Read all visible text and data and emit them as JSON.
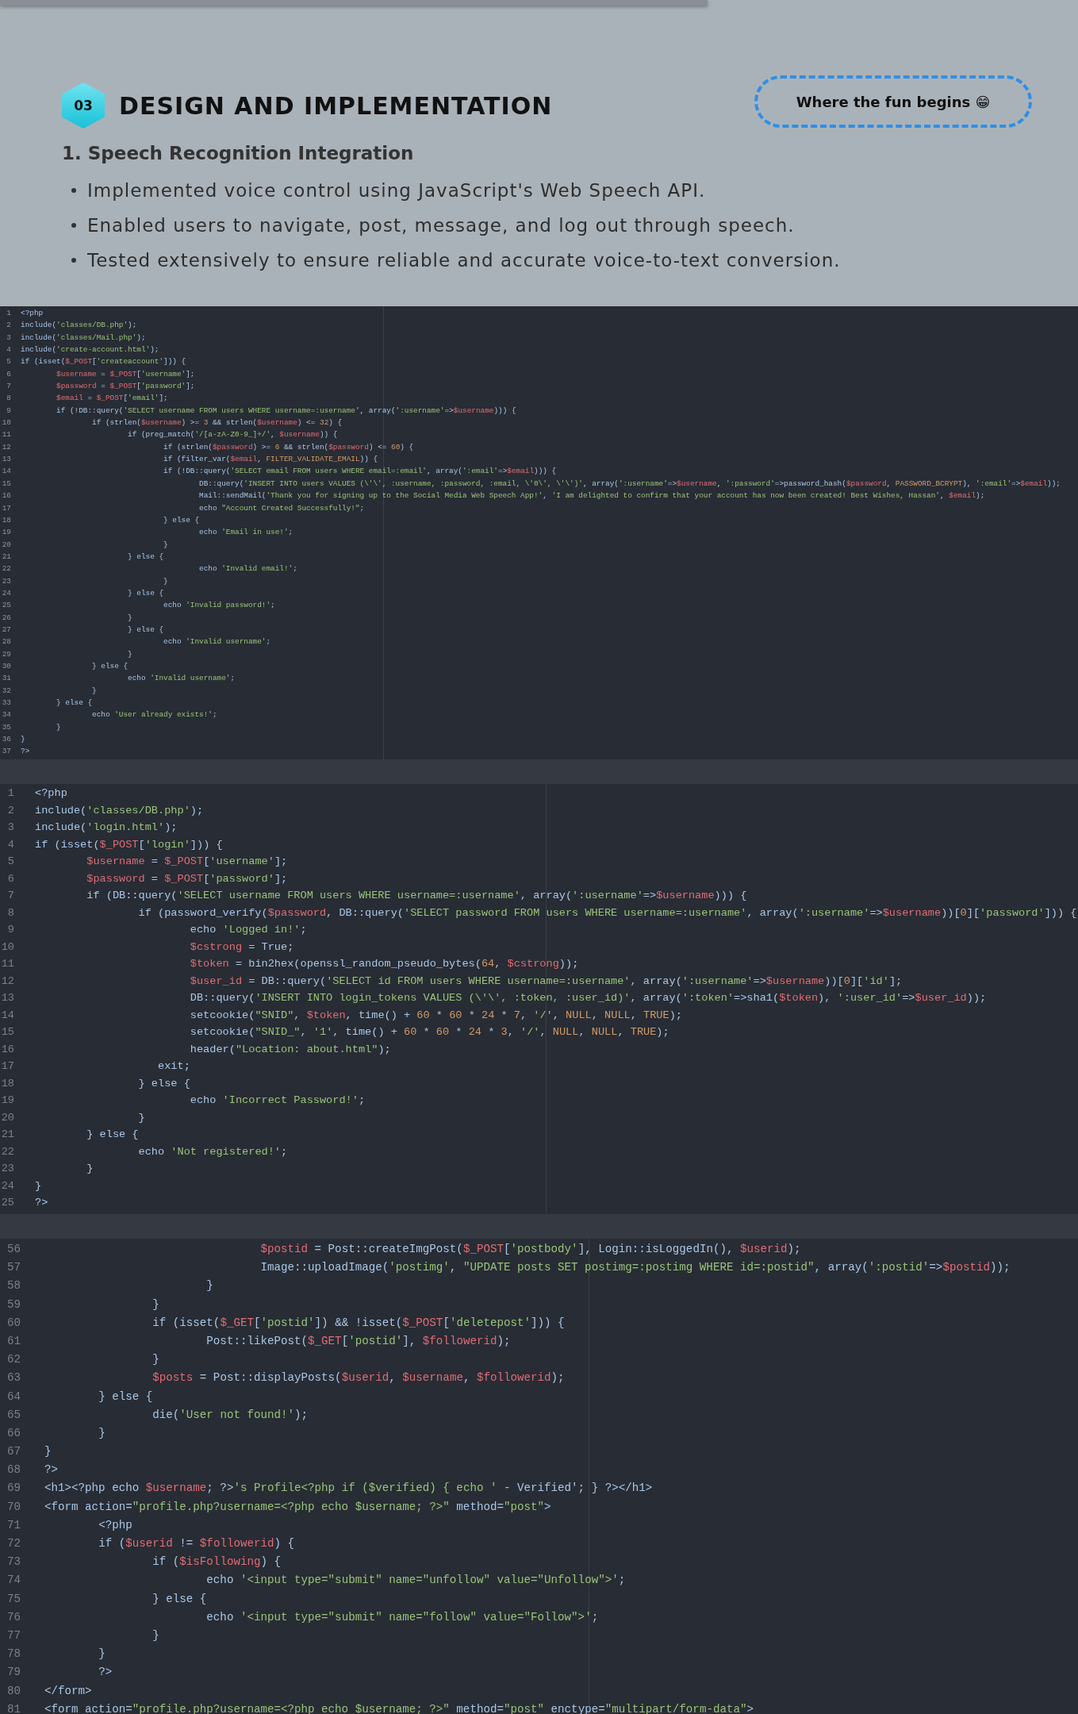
{
  "header": {
    "section_number": "03",
    "title": "DESIGN AND IMPLEMENTATION",
    "tagline": "Where the fun begins 😁",
    "subheading": "1. Speech Recognition Integration",
    "bullets": [
      "Implemented voice control using JavaScript's Web Speech API.",
      "Enabled users to navigate, post, message, and log out through speech.",
      "Tested extensively to ensure reliable and accurate voice-to-text conversion."
    ]
  },
  "code_panels": [
    {
      "kind": "small",
      "lines": [
        {
          "n": "1",
          "code": "<?php"
        },
        {
          "n": "2",
          "code": "include('classes/DB.php');"
        },
        {
          "n": "3",
          "code": "include('classes/Mail.php');"
        },
        {
          "n": "4",
          "code": "include('create-account.html');"
        },
        {
          "n": "5",
          "code": "if (isset($_POST['createaccount'])) {"
        },
        {
          "n": "6",
          "code": "\t$username = $_POST['username'];"
        },
        {
          "n": "7",
          "code": "\t$password = $_POST['password'];"
        },
        {
          "n": "8",
          "code": "\t$email = $_POST['email'];"
        },
        {
          "n": "9",
          "code": "\tif (!DB::query('SELECT username FROM users WHERE username=:username', array(':username'=>$username))) {"
        },
        {
          "n": "10",
          "code": "\t\tif (strlen($username) >= 3 && strlen($username) <= 32) {"
        },
        {
          "n": "11",
          "code": "\t\t\tif (preg_match('/[a-zA-Z0-9_]+/', $username)) {"
        },
        {
          "n": "12",
          "code": "\t\t\t\tif (strlen($password) >= 6 && strlen($password) <= 60) {"
        },
        {
          "n": "13",
          "code": "\t\t\t\tif (filter_var($email, FILTER_VALIDATE_EMAIL)) {"
        },
        {
          "n": "14",
          "code": "\t\t\t\tif (!DB::query('SELECT email FROM users WHERE email=:email', array(':email'=>$email))) {"
        },
        {
          "n": "15",
          "code": "\t\t\t\t\tDB::query('INSERT INTO users VALUES (\\'\\', :username, :password, :email, \\'0\\', \\'\\')', array(':username'=>$username, ':password'=>password_hash($password, PASSWORD_BCRYPT), ':email'=>$email));"
        },
        {
          "n": "16",
          "code": "\t\t\t\t\tMail::sendMail('Thank you for signing up to the Social Media Web Speech App!', 'I am delighted to confirm that your account has now been created! Best Wishes, Hassan', $email);"
        },
        {
          "n": "17",
          "code": "\t\t\t\t\techo \"Account Created Successfully!\";"
        },
        {
          "n": "18",
          "code": "\t\t\t\t} else {"
        },
        {
          "n": "19",
          "code": "\t\t\t\t\techo 'Email in use!';"
        },
        {
          "n": "20",
          "code": "\t\t\t\t}"
        },
        {
          "n": "21",
          "code": "\t\t\t} else {"
        },
        {
          "n": "22",
          "code": "\t\t\t\t\techo 'Invalid email!';"
        },
        {
          "n": "23",
          "code": "\t\t\t\t}"
        },
        {
          "n": "24",
          "code": "\t\t\t} else {"
        },
        {
          "n": "25",
          "code": "\t\t\t\techo 'Invalid password!';"
        },
        {
          "n": "26",
          "code": "\t\t\t}"
        },
        {
          "n": "27",
          "code": "\t\t\t} else {"
        },
        {
          "n": "28",
          "code": "\t\t\t\techo 'Invalid username';"
        },
        {
          "n": "29",
          "code": "\t\t\t}"
        },
        {
          "n": "30",
          "code": "\t\t} else {"
        },
        {
          "n": "31",
          "code": "\t\t\techo 'Invalid username';"
        },
        {
          "n": "32",
          "code": "\t\t}"
        },
        {
          "n": "33",
          "code": "\t} else {"
        },
        {
          "n": "34",
          "code": "\t\techo 'User already exists!';"
        },
        {
          "n": "35",
          "code": "\t}"
        },
        {
          "n": "36",
          "code": "}"
        },
        {
          "n": "37",
          "code": "?>"
        }
      ]
    },
    {
      "kind": "medium",
      "lines": [
        {
          "n": "1",
          "code": "<?php"
        },
        {
          "n": "2",
          "code": "include('classes/DB.php');"
        },
        {
          "n": "3",
          "code": "include('login.html');"
        },
        {
          "n": "4",
          "code": "if (isset($_POST['login'])) {"
        },
        {
          "n": "5",
          "code": "\t$username = $_POST['username'];"
        },
        {
          "n": "6",
          "code": "\t$password = $_POST['password'];"
        },
        {
          "n": "7",
          "code": "\tif (DB::query('SELECT username FROM users WHERE username=:username', array(':username'=>$username))) {"
        },
        {
          "n": "8",
          "code": "\t\tif (password_verify($password, DB::query('SELECT password FROM users WHERE username=:username', array(':username'=>$username))[0]['password'])) {"
        },
        {
          "n": "9",
          "code": "\t\t\techo 'Logged in!';"
        },
        {
          "n": "10",
          "code": "\t\t\t$cstrong = True;"
        },
        {
          "n": "11",
          "code": "\t\t\t$token = bin2hex(openssl_random_pseudo_bytes(64, $cstrong));"
        },
        {
          "n": "12",
          "code": "\t\t\t$user_id = DB::query('SELECT id FROM users WHERE username=:username', array(':username'=>$username))[0]['id'];"
        },
        {
          "n": "13",
          "code": "\t\t\tDB::query('INSERT INTO login_tokens VALUES (\\'\\', :token, :user_id)', array(':token'=>sha1($token), ':user_id'=>$user_id));"
        },
        {
          "n": "14",
          "code": "\t\t\tsetcookie(\"SNID\", $token, time() + 60 * 60 * 24 * 7, '/', NULL, NULL, TRUE);"
        },
        {
          "n": "15",
          "code": "\t\t\tsetcookie(\"SNID_\", '1', time() + 60 * 60 * 24 * 3, '/', NULL, NULL, TRUE);"
        },
        {
          "n": "16",
          "code": "\t\t\theader(\"Location: about.html\");"
        },
        {
          "n": "17",
          "code": "\t\t   exit;"
        },
        {
          "n": "18",
          "code": "\t\t} else {"
        },
        {
          "n": "19",
          "code": "\t\t\techo 'Incorrect Password!';"
        },
        {
          "n": "20",
          "code": "\t\t}"
        },
        {
          "n": "21",
          "code": "\t} else {"
        },
        {
          "n": "22",
          "code": "\t\techo 'Not registered!';"
        },
        {
          "n": "23",
          "code": "\t}"
        },
        {
          "n": "24",
          "code": "}"
        },
        {
          "n": "25",
          "code": "?>"
        }
      ]
    },
    {
      "kind": "large",
      "lines": [
        {
          "n": "56",
          "code": "\t\t\t\t$postid = Post::createImgPost($_POST['postbody'], Login::isLoggedIn(), $userid);"
        },
        {
          "n": "57",
          "code": "\t\t\t\tImage::uploadImage('postimg', \"UPDATE posts SET postimg=:postimg WHERE id=:postid\", array(':postid'=>$postid));"
        },
        {
          "n": "58",
          "code": "\t\t\t}"
        },
        {
          "n": "59",
          "code": "\t\t}"
        },
        {
          "n": "60",
          "code": "\t\tif (isset($_GET['postid']) && !isset($_POST['deletepost'])) {"
        },
        {
          "n": "61",
          "code": "\t\t\tPost::likePost($_GET['postid'], $followerid);"
        },
        {
          "n": "62",
          "code": "\t\t}"
        },
        {
          "n": "63",
          "code": "\t\t$posts = Post::displayPosts($userid, $username, $followerid);"
        },
        {
          "n": "64",
          "code": "\t} else {"
        },
        {
          "n": "65",
          "code": "\t\tdie('User not found!');"
        },
        {
          "n": "66",
          "code": "\t}"
        },
        {
          "n": "67",
          "code": "}"
        },
        {
          "n": "68",
          "code": "?>"
        },
        {
          "n": "69",
          "code": "<h1><?php echo $username; ?>'s Profile<?php if ($verified) { echo ' - Verified'; } ?></h1>"
        },
        {
          "n": "70",
          "code": "<form action=\"profile.php?username=<?php echo $username; ?>\" method=\"post\">"
        },
        {
          "n": "71",
          "code": "\t<?php"
        },
        {
          "n": "72",
          "code": "\tif ($userid != $followerid) {"
        },
        {
          "n": "73",
          "code": "\t\tif ($isFollowing) {"
        },
        {
          "n": "74",
          "code": "\t\t\techo '<input type=\"submit\" name=\"unfollow\" value=\"Unfollow\">';"
        },
        {
          "n": "75",
          "code": "\t\t} else {"
        },
        {
          "n": "76",
          "code": "\t\t\techo '<input type=\"submit\" name=\"follow\" value=\"Follow\">';"
        },
        {
          "n": "77",
          "code": "\t\t}"
        },
        {
          "n": "78",
          "code": "\t}"
        },
        {
          "n": "79",
          "code": "\t?>"
        },
        {
          "n": "80",
          "code": "</form>"
        },
        {
          "n": "81",
          "code": "<form action=\"profile.php?username=<?php echo $username; ?>\" method=\"post\" enctype=\"multipart/form-data\">"
        }
      ]
    }
  ]
}
